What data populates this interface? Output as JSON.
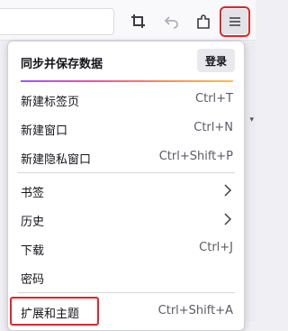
{
  "menu": {
    "sync_title": "同步并保存数据",
    "login_label": "登录",
    "items": [
      {
        "label": "新建标签页",
        "shortcut": "Ctrl+T"
      },
      {
        "label": "新建窗口",
        "shortcut": "Ctrl+N"
      },
      {
        "label": "新建隐私窗口",
        "shortcut": "Ctrl+Shift+P"
      },
      {
        "label": "书签",
        "shortcut": ""
      },
      {
        "label": "历史",
        "shortcut": ""
      },
      {
        "label": "下载",
        "shortcut": "Ctrl+J"
      },
      {
        "label": "密码",
        "shortcut": ""
      },
      {
        "label": "扩展和主题",
        "shortcut": "Ctrl+Shift+A"
      }
    ]
  },
  "toolbar": {
    "icons": [
      "crop-icon",
      "undo-icon",
      "extensions-icon",
      "hamburger-menu-icon"
    ]
  },
  "colors": {
    "highlight": "#e0262b"
  }
}
